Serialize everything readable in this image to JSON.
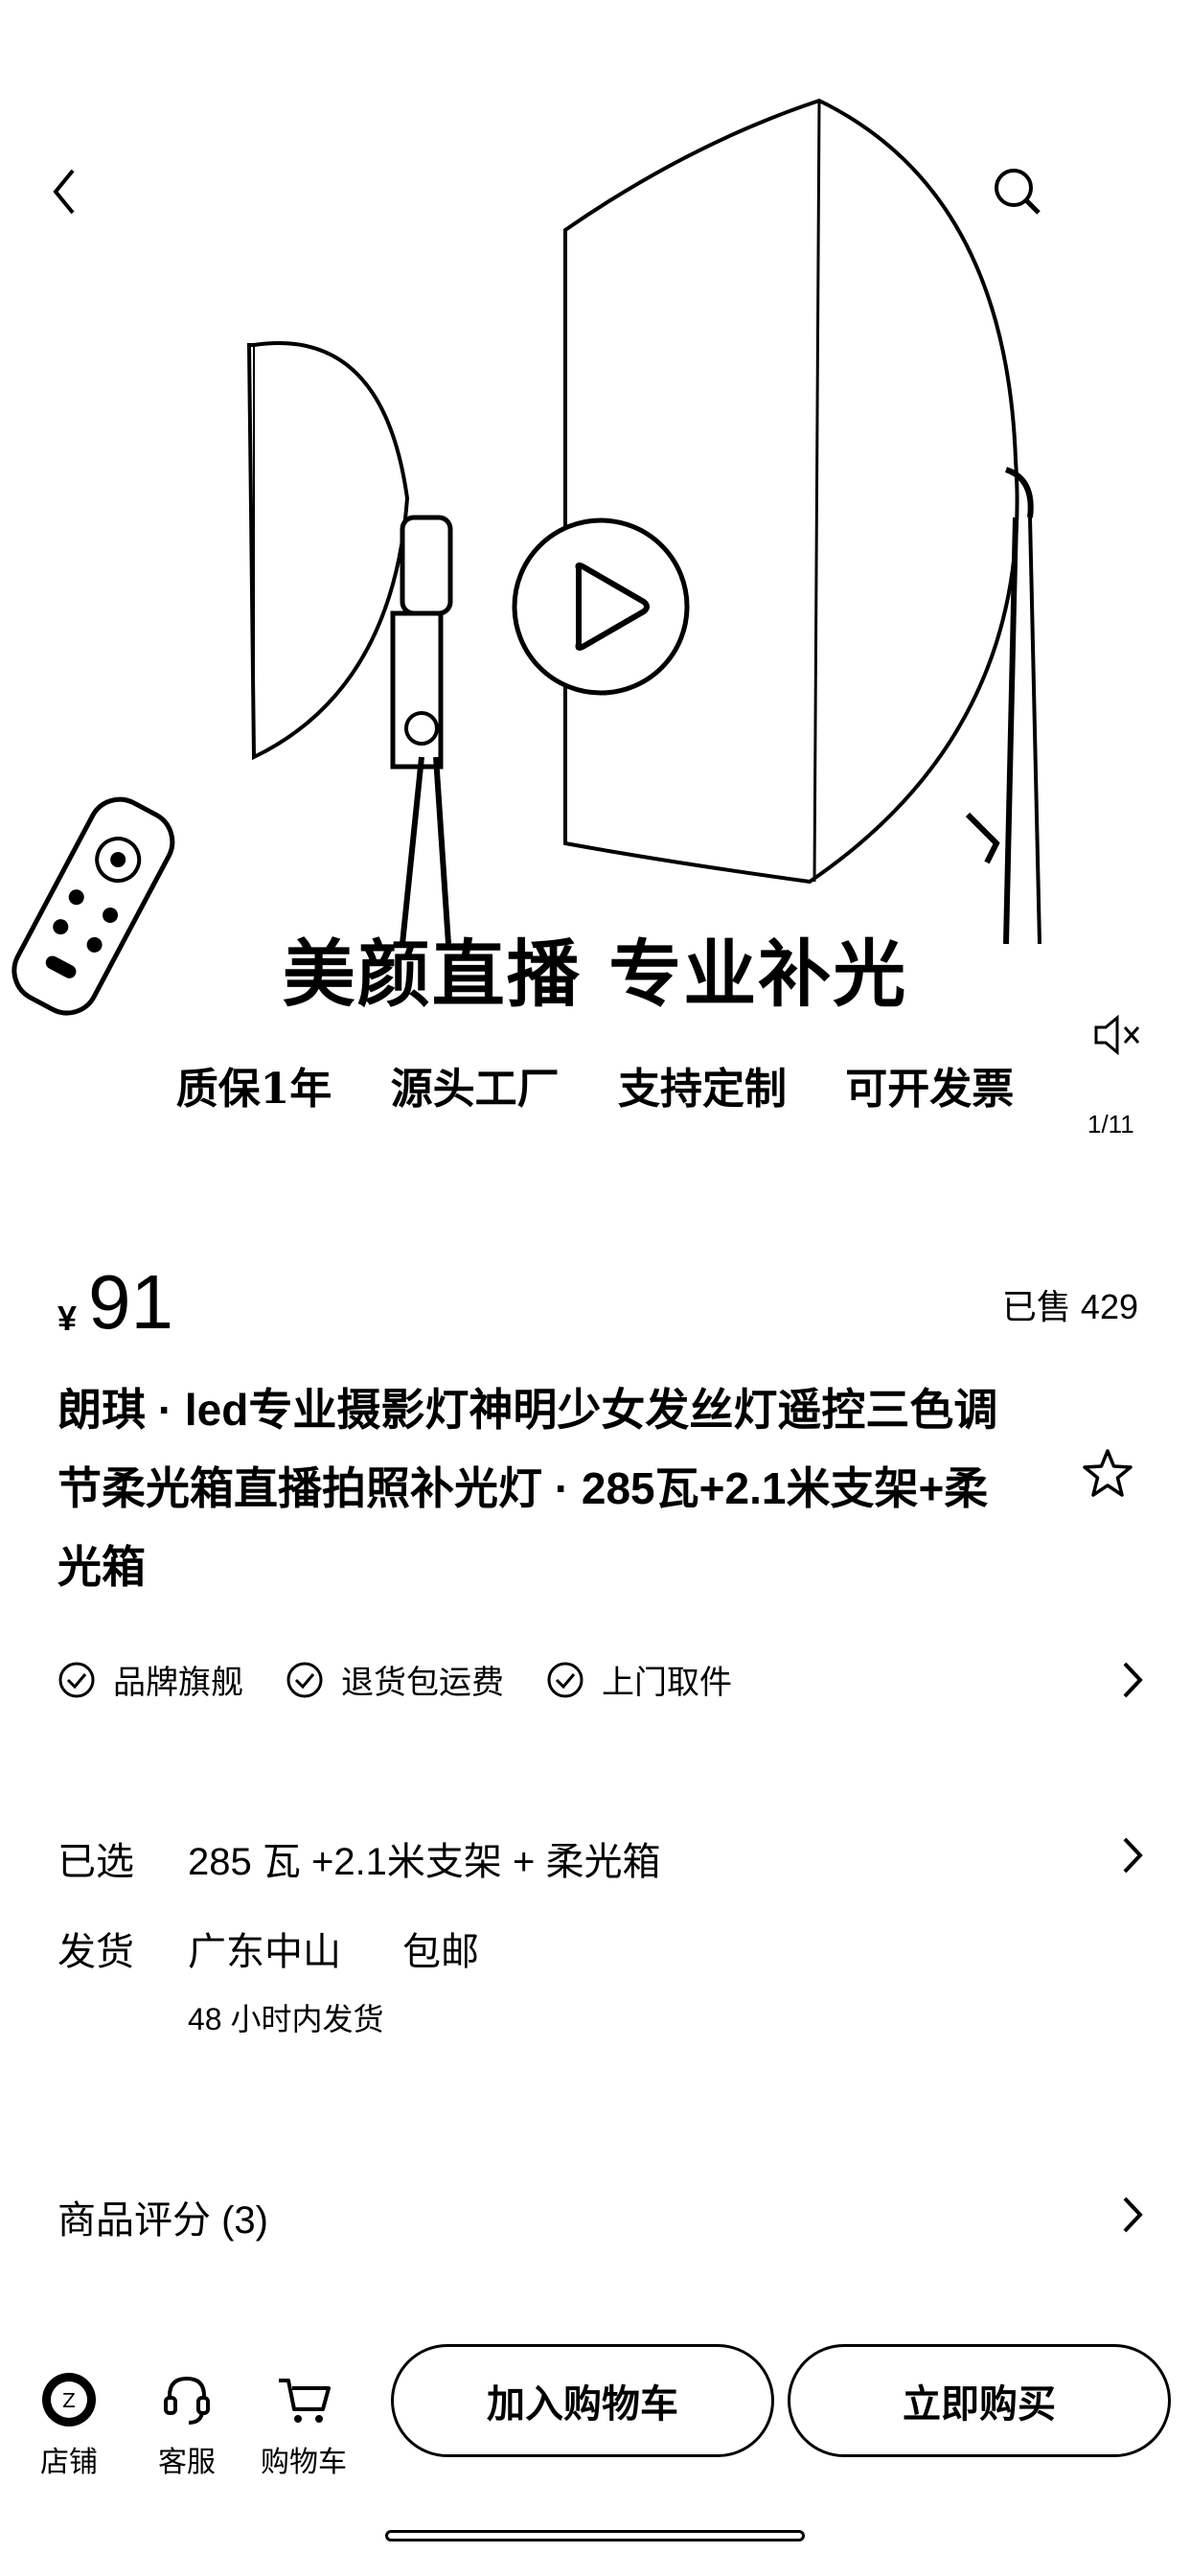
{
  "hero": {
    "headline": "美颜直播 专业补光",
    "features": [
      "质保1年",
      "源头工厂",
      "支持定制",
      "可开发票"
    ],
    "counter": "1/11",
    "icons": [
      "back-icon",
      "search-icon",
      "play-icon",
      "mute-icon"
    ]
  },
  "product": {
    "currency": "¥",
    "price": "91",
    "sold": "已售 429",
    "title": "朗琪 · led专业摄影灯神明少女发丝灯遥控三色调节柔光箱直播拍照补光灯 · 285瓦+2.1米支架+柔光箱"
  },
  "badges": [
    "品牌旗舰",
    "退货包运费",
    "上门取件"
  ],
  "selected": {
    "label": "已选",
    "value": "285 瓦 +2.1米支架 + 柔光箱"
  },
  "shipping": {
    "label": "发货",
    "origin": "广东中山",
    "fee": "包邮",
    "note": "48 小时内发货"
  },
  "reviews": {
    "label": "商品评分 (3)"
  },
  "bottom_bar": {
    "shop": "店铺",
    "service": "客服",
    "cart": "购物车",
    "add_to_cart": "加入购物车",
    "buy_now": "立即购买"
  }
}
